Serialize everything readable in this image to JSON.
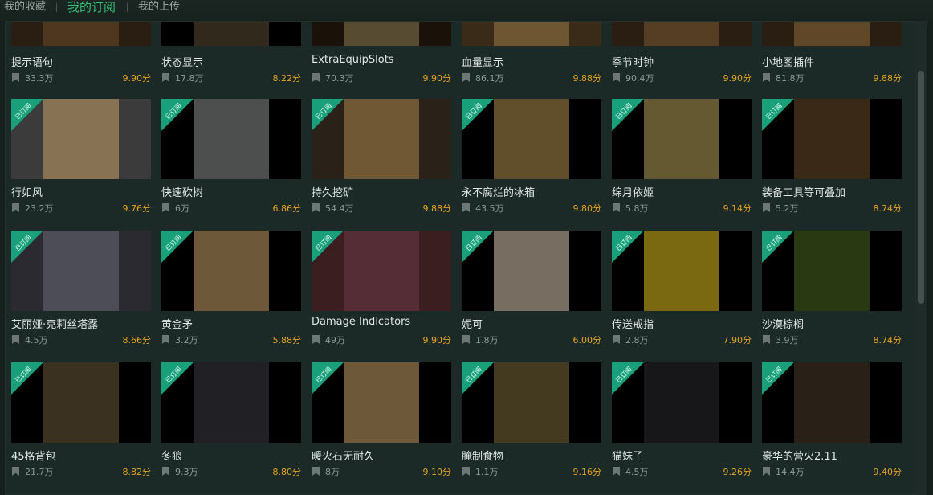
{
  "tabs": [
    {
      "label": "我的收藏",
      "active": false
    },
    {
      "label": "我的订阅",
      "active": true
    },
    {
      "label": "我的上传",
      "active": false
    }
  ],
  "badge_label": "已订阅",
  "colors": {
    "accent": "#33c178",
    "score": "#e3a21f",
    "badge": "#19a07a"
  },
  "rows": [
    {
      "items": [
        {
          "title": "提示语句",
          "count": "33.3万",
          "score": "9.90分",
          "subscribed": false,
          "thumb_bg": "#2a1e12",
          "art": "#6b4a2a"
        },
        {
          "title": "状态显示",
          "count": "17.8万",
          "score": "8.22分",
          "subscribed": false,
          "thumb_bg": "#000000",
          "art": "#5a4a33"
        },
        {
          "title": "ExtraEquipSlots",
          "count": "70.3万",
          "score": "9.90分",
          "subscribed": false,
          "thumb_bg": "#1a1208",
          "art": "#8a7a55"
        },
        {
          "title": "血量显示",
          "count": "86.1万",
          "score": "9.88分",
          "subscribed": false,
          "thumb_bg": "#3a2a18",
          "art": "#9a7a4a"
        },
        {
          "title": "季节时钟",
          "count": "90.4万",
          "score": "9.90分",
          "subscribed": false,
          "thumb_bg": "#2a1e12",
          "art": "#7a5a33"
        },
        {
          "title": "小地图插件",
          "count": "81.8万",
          "score": "9.88分",
          "subscribed": false,
          "thumb_bg": "#2a1e12",
          "art": "#8a6a3a"
        }
      ]
    },
    {
      "items": [
        {
          "title": "行如风",
          "count": "23.2万",
          "score": "9.76分",
          "subscribed": true,
          "thumb_bg": "#3b3b3b",
          "art": "#c9a06a"
        },
        {
          "title": "快速砍树",
          "count": "6万",
          "score": "6.86分",
          "subscribed": true,
          "thumb_bg": "#000000",
          "art": "#8a8f8c"
        },
        {
          "title": "持久挖矿",
          "count": "54.4万",
          "score": "9.88分",
          "subscribed": true,
          "thumb_bg": "#2a2118",
          "art": "#a8864a"
        },
        {
          "title": "永不腐烂的冰箱",
          "count": "43.5万",
          "score": "9.80分",
          "subscribed": true,
          "thumb_bg": "#000000",
          "art": "#b0904e"
        },
        {
          "title": "绵月依姬",
          "count": "5.8万",
          "score": "9.14分",
          "subscribed": true,
          "thumb_bg": "#000000",
          "art": "#b8a25a"
        },
        {
          "title": "装备工具等可叠加",
          "count": "5.2万",
          "score": "8.74分",
          "subscribed": true,
          "thumb_bg": "#000000",
          "art": "#6a4a2a"
        }
      ]
    },
    {
      "items": [
        {
          "title": "艾丽娅·克莉丝塔露",
          "count": "4.5万",
          "score": "8.66分",
          "subscribed": true,
          "thumb_bg": "#2a2a30",
          "art": "#6a6a7a"
        },
        {
          "title": "黄金矛",
          "count": "3.2万",
          "score": "5.88分",
          "subscribed": true,
          "thumb_bg": "#000000",
          "art": "#c9a06a"
        },
        {
          "title": "Damage Indicators",
          "count": "49万",
          "score": "9.90分",
          "subscribed": true,
          "thumb_bg": "#3a1e20",
          "art": "#6a3a4a"
        },
        {
          "title": "妮可",
          "count": "1.8万",
          "score": "6.00分",
          "subscribed": true,
          "thumb_bg": "#000000",
          "art": "#d8c8b0"
        },
        {
          "title": "传送戒指",
          "count": "2.8万",
          "score": "7.90分",
          "subscribed": true,
          "thumb_bg": "#000000",
          "art": "#e0c020"
        },
        {
          "title": "沙漠棕榈",
          "count": "3.9万",
          "score": "8.74分",
          "subscribed": true,
          "thumb_bg": "#000000",
          "art": "#4a6a20"
        }
      ]
    },
    {
      "items": [
        {
          "title": "45格背包",
          "count": "21.7万",
          "score": "8.82分",
          "subscribed": true,
          "thumb_bg": "#000000",
          "art": "#6a5a3a"
        },
        {
          "title": "冬狼",
          "count": "9.3万",
          "score": "8.80分",
          "subscribed": true,
          "thumb_bg": "#000000",
          "art": "#3a3a44"
        },
        {
          "title": "暖火石无耐久",
          "count": "8万",
          "score": "9.10分",
          "subscribed": true,
          "thumb_bg": "#000000",
          "art": "#c9a06a"
        },
        {
          "title": "腌制食物",
          "count": "1.1万",
          "score": "9.16分",
          "subscribed": true,
          "thumb_bg": "#000000",
          "art": "#7a6a3a"
        },
        {
          "title": "猫妹子",
          "count": "4.5万",
          "score": "9.26分",
          "subscribed": true,
          "thumb_bg": "#000000",
          "art": "#2a2a30"
        },
        {
          "title": "豪华的营火2.11",
          "count": "14.4万",
          "score": "9.40分",
          "subscribed": true,
          "thumb_bg": "#000000",
          "art": "#4a3a2a"
        }
      ]
    }
  ]
}
